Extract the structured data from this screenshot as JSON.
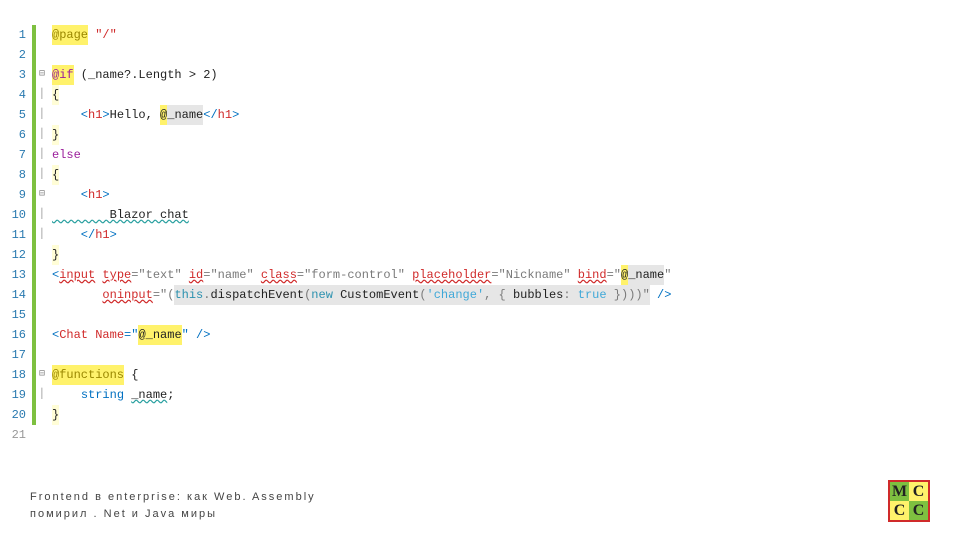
{
  "lines": {
    "l1": {
      "a": "@page",
      "b": " \"/\""
    },
    "l3": {
      "a": "@if",
      "b": " (_name?.Length > 2)"
    },
    "l4": "{",
    "l5": {
      "a": "    <",
      "b": "h1",
      "c": ">",
      "d": "Hello, ",
      "e": "@",
      "f": "_name",
      "g": "</",
      "h": "h1",
      "i": ">"
    },
    "l6": "}",
    "l7": "else",
    "l8": "{",
    "l9": {
      "a": "    <",
      "b": "h1",
      "c": ">"
    },
    "l10": "        Blazor chat",
    "l11": {
      "a": "    </",
      "b": "h1",
      "c": ">"
    },
    "l12": "}",
    "l13": {
      "a": "<",
      "b": "input",
      "c": " ",
      "d": "type",
      "e": "=\"text\"",
      "f": " ",
      "g": "id",
      "h": "=\"name\"",
      "i": " ",
      "j": "class",
      "k": "=\"form-control\"",
      "l": " ",
      "m": "placeholder",
      "n": "=\"Nickname\"",
      "o": " ",
      "p": "bind",
      "q": "=\"",
      "r": "@",
      "s": "_name",
      "t": "\""
    },
    "l14": {
      "a": "       ",
      "b": "oninput",
      "c": "=\"(",
      "d": "this",
      "e": ".",
      "f": "dispatchEvent",
      "g": "(",
      "h": "new",
      "i": " ",
      "j": "CustomEvent",
      "k": "(",
      "l": "'change'",
      "m": ", { ",
      "n": "bubbles",
      "o": ": ",
      "p": "true",
      "q": " })))\"",
      "r": " />"
    },
    "l16": {
      "a": "<",
      "b": "Chat",
      "c": " ",
      "d": "Name",
      "e": "=\"",
      "f": "@_name",
      "g": "\"",
      "h": " />"
    },
    "l18": {
      "a": "@functions",
      "b": " {"
    },
    "l19": {
      "a": "    ",
      "b": "string",
      "c": " ",
      "d": "_name",
      "e": ";"
    },
    "l20": "}"
  },
  "gutter": [
    "1",
    "2",
    "3",
    "4",
    "5",
    "6",
    "7",
    "8",
    "9",
    "10",
    "11",
    "12",
    "13",
    "14",
    "15",
    "16",
    "17",
    "18",
    "19",
    "20",
    "21"
  ],
  "footer": {
    "line1": "Frontend в enterprise: как Web. Assembly",
    "line2": "помирил . Net и Java миры"
  },
  "logo": {
    "tl": "M",
    "tr": "C",
    "bl": "C",
    "br": "C"
  }
}
